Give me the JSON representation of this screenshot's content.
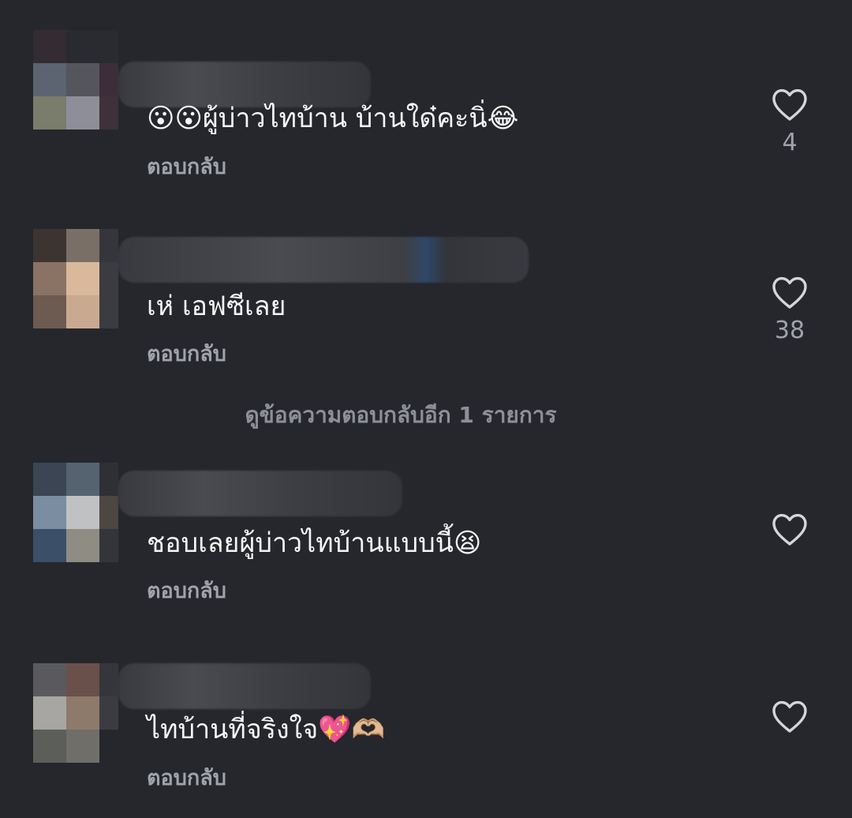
{
  "comments": [
    {
      "text": "😮😮ผู้บ่าวไทบ้าน บ้านใด๋คะนิ่😂",
      "reply_label": "ตอบกลับ",
      "likes": "4"
    },
    {
      "text": "เห่ เอฟซีเลย",
      "reply_label": "ตอบกลับ",
      "likes": "38"
    },
    {
      "text": "ชอบเลยผู้บ่าวไทบ้านแบบนี้😫",
      "reply_label": "ตอบกลับ",
      "likes": ""
    },
    {
      "text": "ไทบ้านที่จริงใจ💖🫶🏼",
      "reply_label": "ตอบกลับ",
      "likes": ""
    }
  ],
  "view_more_replies": "ดูข้อความตอบกลับอีก 1 รายการ",
  "icons": {
    "like": "heart-outline-icon"
  },
  "colors": {
    "background": "#25272c",
    "secondary_text": "#a0a3aa"
  }
}
